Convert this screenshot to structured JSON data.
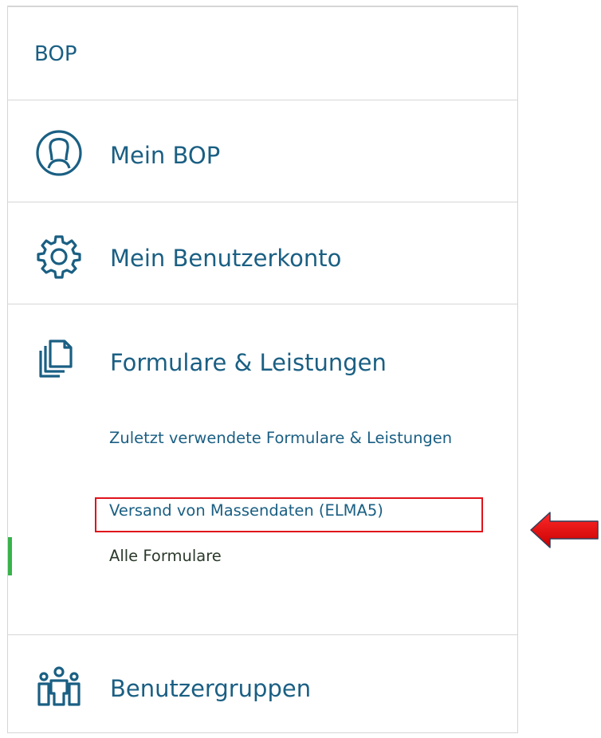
{
  "header": {
    "title": "BOP"
  },
  "nav": {
    "mein_bop": {
      "label": "Mein BOP",
      "icon": "user-circle-icon"
    },
    "benutzerkonto": {
      "label": "Mein Benutzerkonto",
      "icon": "gear-icon"
    },
    "formulare": {
      "label": "Formulare & Leistungen",
      "icon": "documents-icon",
      "sub_items": [
        {
          "label": "Zuletzt verwendete Formulare & Leistungen"
        },
        {
          "label": "Versand von Massendaten (ELMA5)",
          "highlighted": true
        },
        {
          "label": "Alle Formulare",
          "active": true
        }
      ]
    },
    "benutzergruppen": {
      "label": "Benutzergruppen",
      "icon": "user-group-icon"
    }
  },
  "annotation": {
    "arrow_color": "#e0131a",
    "box_color": "#e0131a"
  },
  "colors": {
    "text": "#1a5f83",
    "active_bar": "#38b24b",
    "border": "#d6d6d6"
  }
}
